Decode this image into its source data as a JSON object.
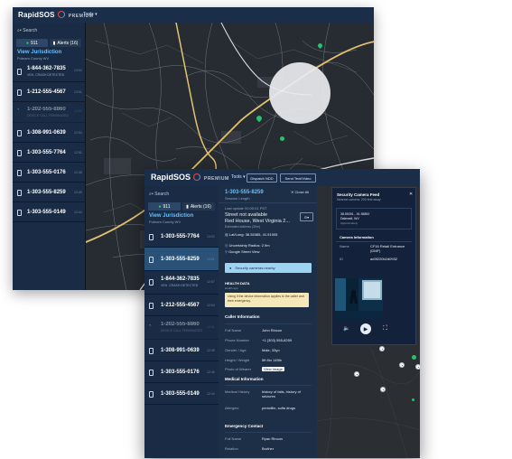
{
  "app": {
    "brand": "RapidSOS",
    "tier": "PREMIUM",
    "tools_label": "Tools"
  },
  "back": {
    "search_label": "Search",
    "tabs": [
      "911",
      "Alerts (16)"
    ],
    "jurisdiction": {
      "title": "View Jurisdiction",
      "subtitle": "Putnam County WV"
    },
    "calls": [
      {
        "phone": "1-844-362-7835",
        "sub": "VEH. CRASH DETECTED",
        "time": "13:02"
      },
      {
        "phone": "1-212-555-4567",
        "sub": "",
        "time": "13:01"
      },
      {
        "phone": "1-202-555-8860",
        "sub": "DEVICE CALL TERMINATED",
        "time": "12:57"
      },
      {
        "phone": "1-308-991-0639",
        "sub": "",
        "time": "12:54"
      },
      {
        "phone": "1-303-555-7764",
        "sub": "",
        "time": "12:51"
      },
      {
        "phone": "1-303-555-0176",
        "sub": "",
        "time": "12:48"
      },
      {
        "phone": "1-303-555-8259",
        "sub": "",
        "time": "12:46"
      },
      {
        "phone": "1-303-555-0149",
        "sub": "",
        "time": "12:44"
      }
    ]
  },
  "front": {
    "toolbar": {
      "dispatch_label": "Dispatch NDD",
      "send_label": "Send Text/Video"
    },
    "search_label": "Search",
    "tabs": [
      "911",
      "Alerts (16)"
    ],
    "jurisdiction": {
      "title": "View Jurisdiction",
      "subtitle": "Putnam County WV"
    },
    "calls": [
      {
        "phone": "1-303-555-7764",
        "sub": "",
        "time": "13:02"
      },
      {
        "phone": "1-303-555-8259",
        "sub": "",
        "time": "13:01"
      },
      {
        "phone": "1-844-362-7835",
        "sub": "VEH. CRASH DETECTED",
        "time": "12:57"
      },
      {
        "phone": "1-212-555-4567",
        "sub": "",
        "time": "12:54"
      },
      {
        "phone": "1-202-555-8860",
        "sub": "DEVICE CALL TERMINATED",
        "time": "12:51"
      },
      {
        "phone": "1-308-991-0639",
        "sub": "",
        "time": "12:48"
      },
      {
        "phone": "1-303-555-0176",
        "sub": "",
        "time": "12:46"
      },
      {
        "phone": "1-303-555-0149",
        "sub": "",
        "time": "12:44"
      }
    ],
    "detail": {
      "phone": "1-303-555-8259",
      "phone_sub": "Session Length",
      "close_label": "Close All",
      "last_update": "Last update 00:00:01 PST",
      "street": "Street not available",
      "city": "Red House, West Virginia 2...",
      "city_note": "Estimated address (30m)",
      "latlong": "Lat/Long: 38.55385, 41.91905",
      "uncertainty": "Uncertainty Radius: 2.9m",
      "street_view": "Google Street View",
      "security_button": "Security cameras nearby",
      "health_title": "HEALTH DATA",
      "health_sub": "Health app",
      "health_notice": "Using if the device information applies to the caller and their emergency.",
      "caller_title": "Caller Information",
      "caller": [
        {
          "key": "Full Name",
          "value": "John Rincon"
        },
        {
          "key": "Phone Number",
          "value": "+1 (303) 555-8259"
        },
        {
          "key": "Gender / Age",
          "value": "Male, 33yo"
        },
        {
          "key": "Height / Weight",
          "value": "5ft 8in 145lb"
        },
        {
          "key": "Photo of Wearer",
          "value": "View Image"
        }
      ],
      "medical_title": "Medical Information",
      "medical": [
        {
          "key": "Medical History",
          "value": "history of falls, history of seizures"
        },
        {
          "key": "Allergies",
          "value": "penicillin, sulfa drugs"
        }
      ],
      "emergency_title": "Emergency Contact",
      "emergency": [
        {
          "key": "Full Name",
          "value": "Ryan Rincon"
        },
        {
          "key": "Relation",
          "value": "Brother"
        }
      ]
    },
    "camera": {
      "title": "Security Camera Feed",
      "subtitle": "Nearest camera: 200 feet away",
      "coords": "38.55391, -91.95892",
      "place": "Dalewell, WV",
      "place_note": "Approximately",
      "info_title": "Camera Information",
      "rows": [
        {
          "key": "Name",
          "value": "CF16 Retail Entrance (DMF)"
        },
        {
          "key": "ID",
          "value": "ad3f220b2d0932"
        }
      ]
    }
  },
  "colors": {
    "accent": "#3fa9f5",
    "brand_red": "#e74c3c",
    "marker_green": "#27c26a"
  }
}
